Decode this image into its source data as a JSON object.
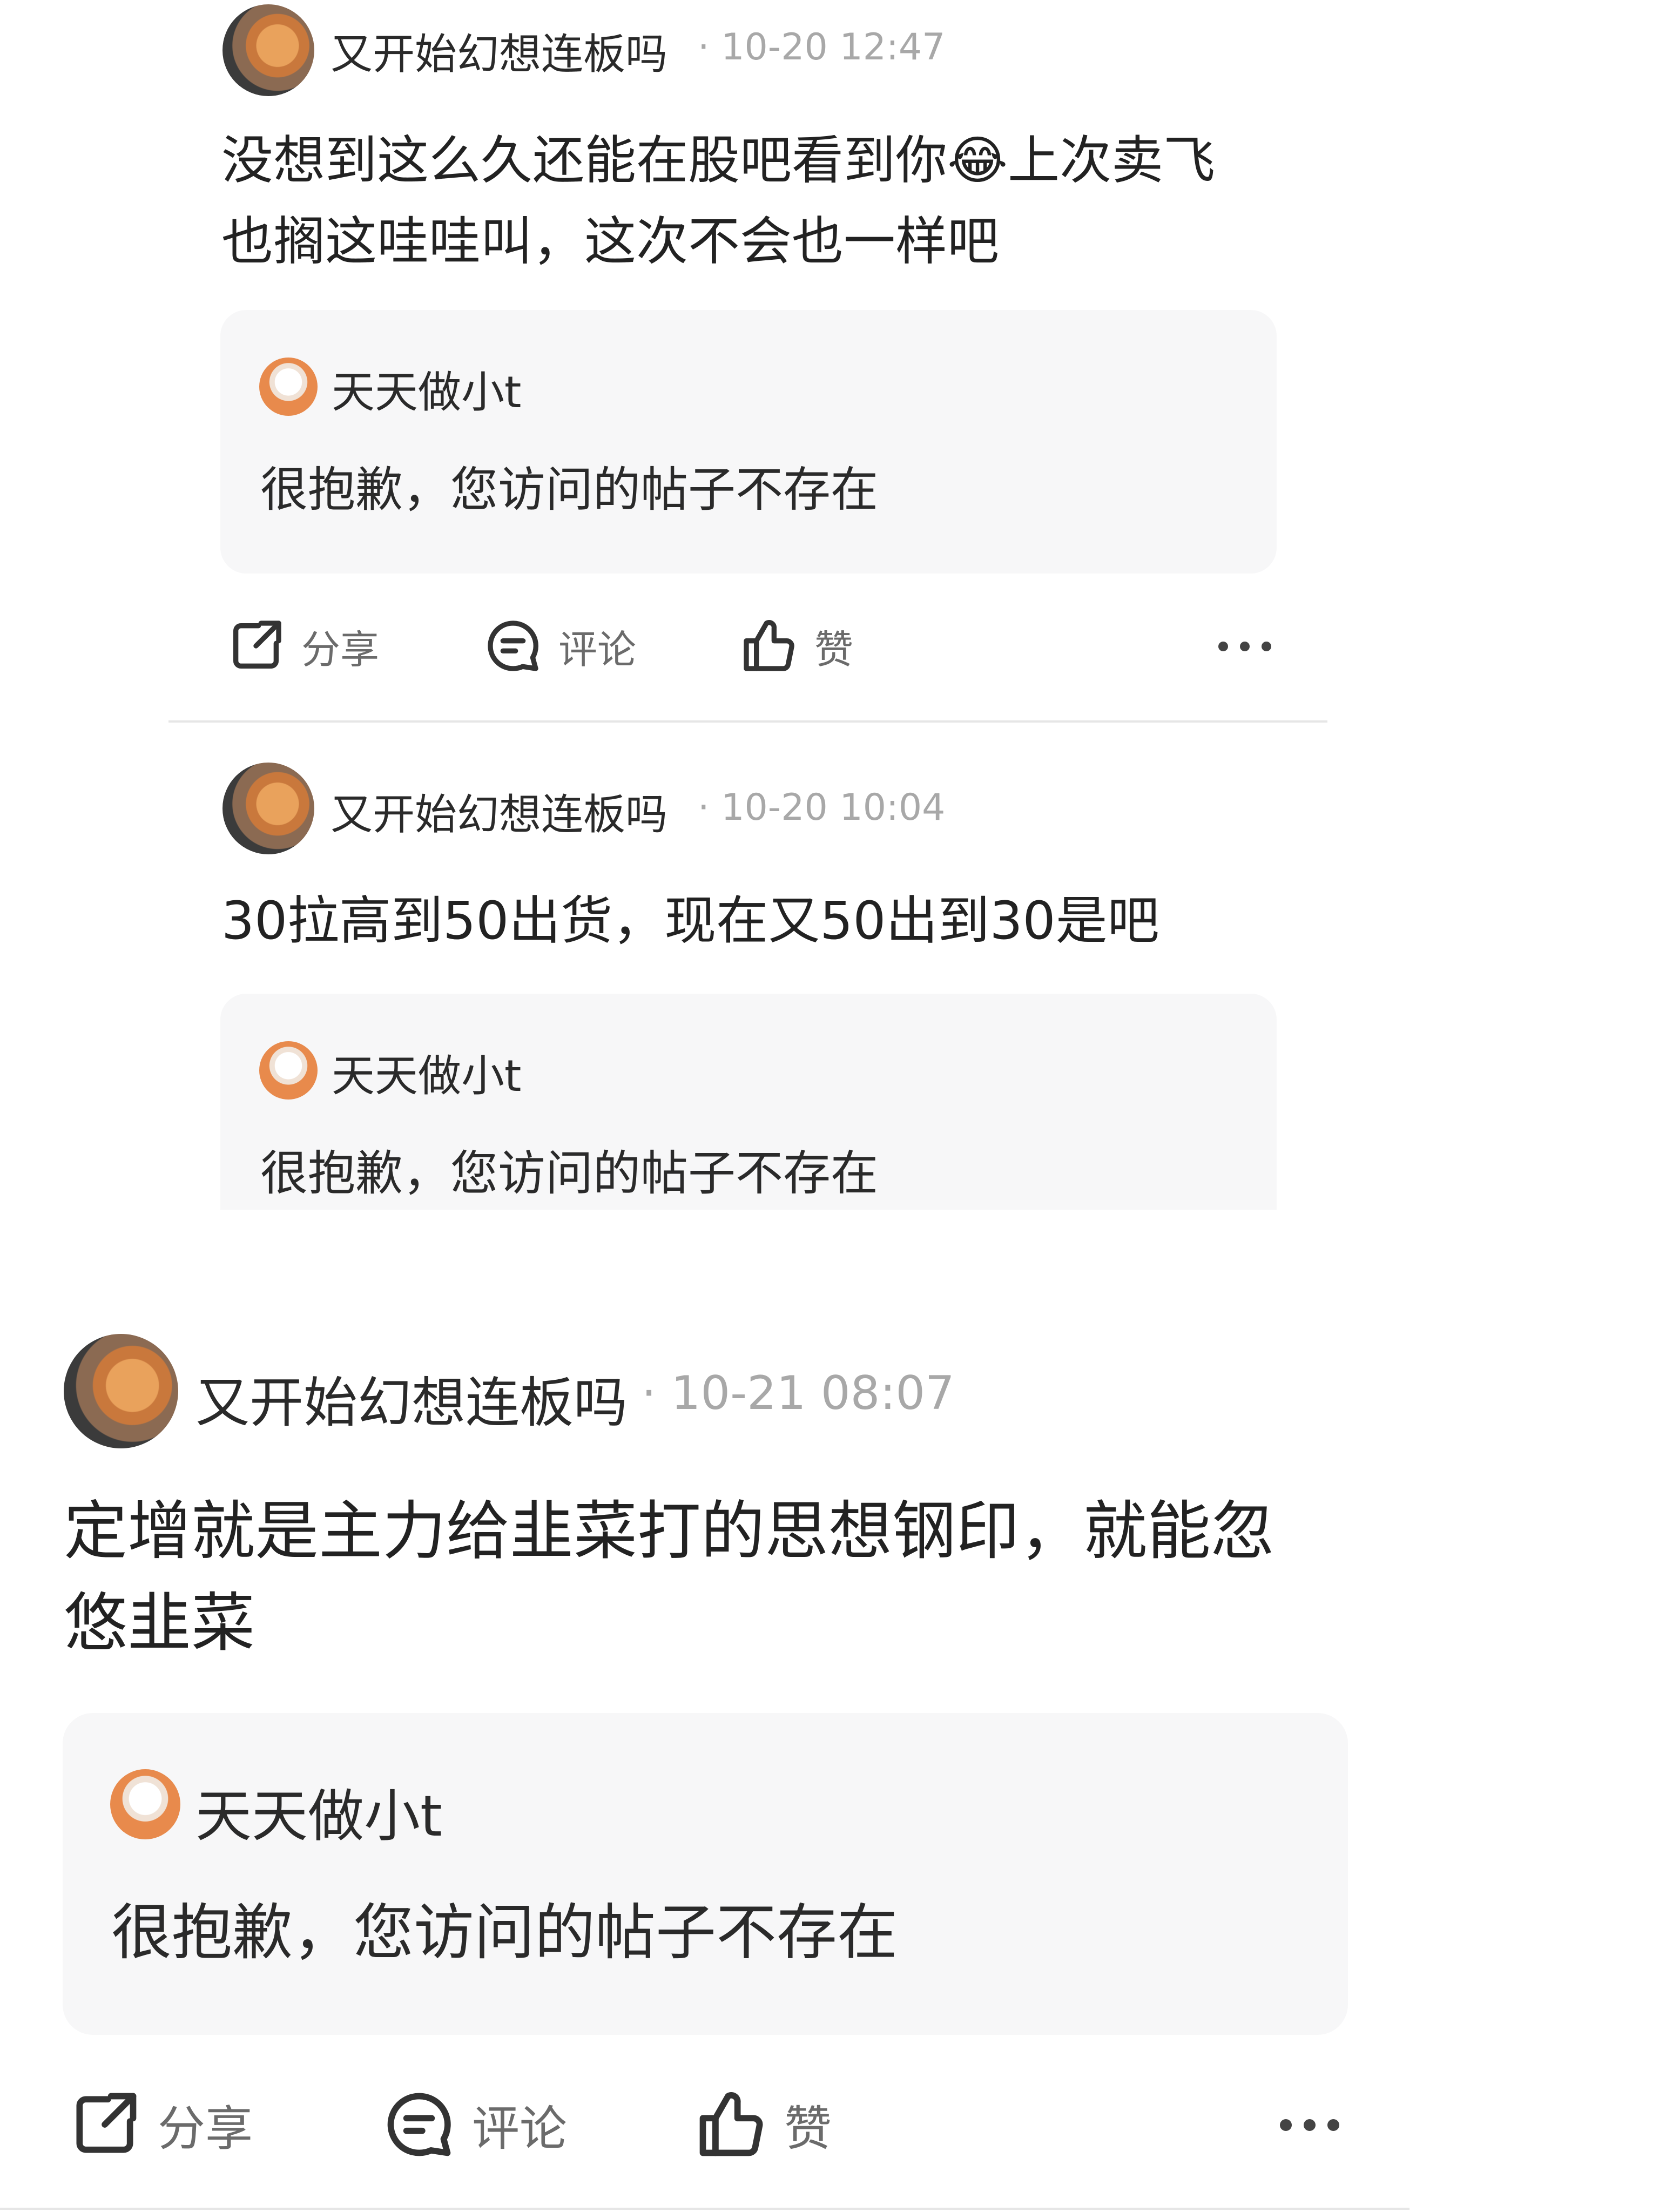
{
  "comments": [
    {
      "author": "又开始幻想连板吗",
      "meta": "· 10-20 12:47",
      "text_line1": "没想到这么久还能在股吧看到你😂上次卖飞",
      "text_line2": "也搁这哇哇叫，这次不会也一样吧",
      "quote_author": "天天做小t",
      "quote_text": "很抱歉，您访问的帖子不存在"
    },
    {
      "author": "又开始幻想连板吗",
      "meta": "· 10-20 10:04",
      "text_line1": "30拉高到50出货，现在又50出到30是吧",
      "quote_author": "天天做小t",
      "quote_text": "很抱歉，您访问的帖子不存在"
    },
    {
      "author": "又开始幻想连板吗",
      "meta": "· 10-21 08:07",
      "text_line1": "定增就是主力给韭菜打的思想钢印，就能忽",
      "text_line2": "悠韭菜",
      "quote_author": "天天做小t",
      "quote_text": "很抱歉，您访问的帖子不存在"
    }
  ],
  "actions": {
    "share": "分享",
    "comment": "评论",
    "like": "赞"
  }
}
